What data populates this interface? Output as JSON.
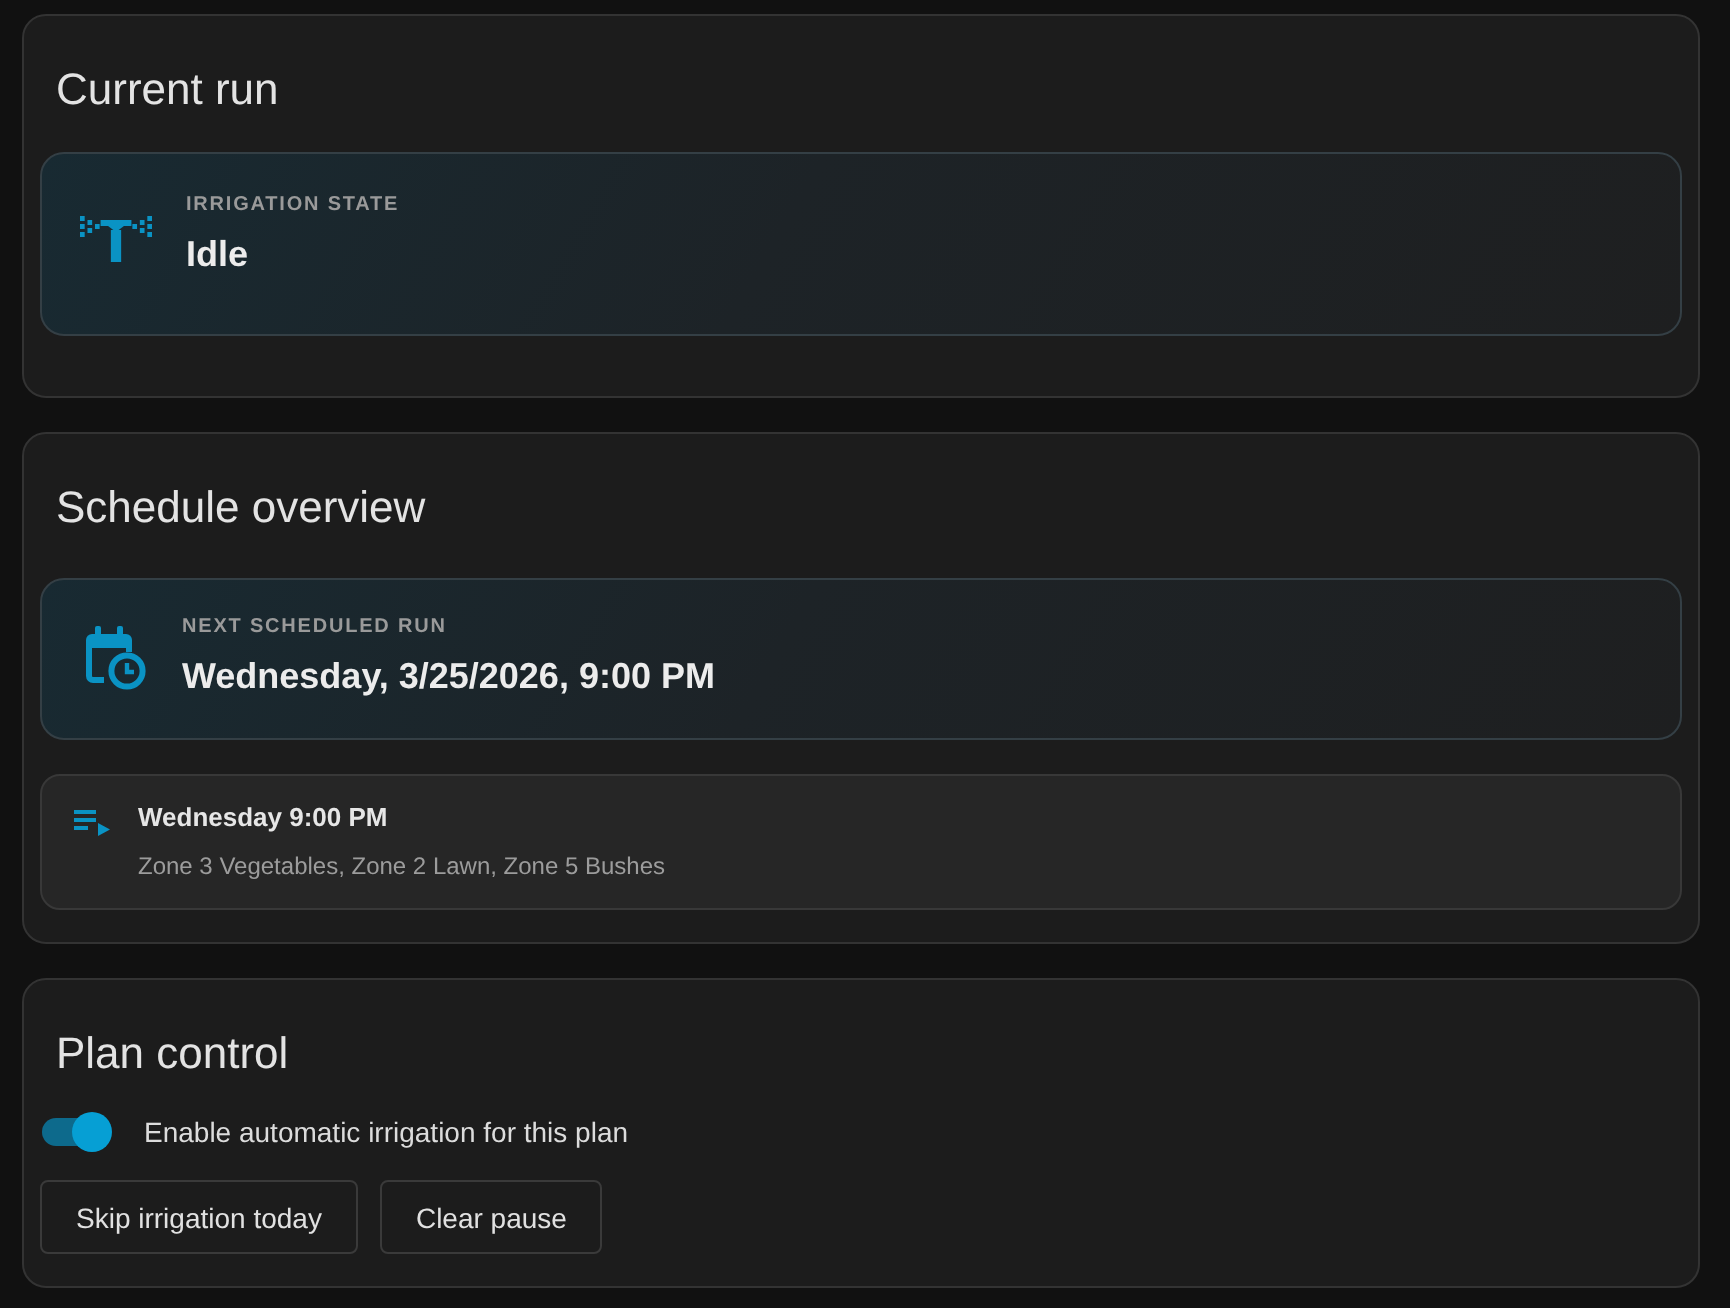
{
  "current_run": {
    "title": "Current run",
    "state": {
      "label": "IRRIGATION STATE",
      "value": "Idle"
    }
  },
  "schedule_overview": {
    "title": "Schedule overview",
    "next_run": {
      "label": "NEXT SCHEDULED RUN",
      "value": "Wednesday, 3/25/2026, 9:00 PM"
    },
    "schedules": [
      {
        "title": "Wednesday 9:00 PM",
        "zones": "Zone 3 Vegetables, Zone 2 Lawn, Zone 5 Bushes"
      }
    ]
  },
  "plan_control": {
    "title": "Plan control",
    "toggle": {
      "label": "Enable automatic irrigation for this plan",
      "on": true
    },
    "buttons": [
      "Skip irrigation today",
      "Clear pause"
    ]
  }
}
